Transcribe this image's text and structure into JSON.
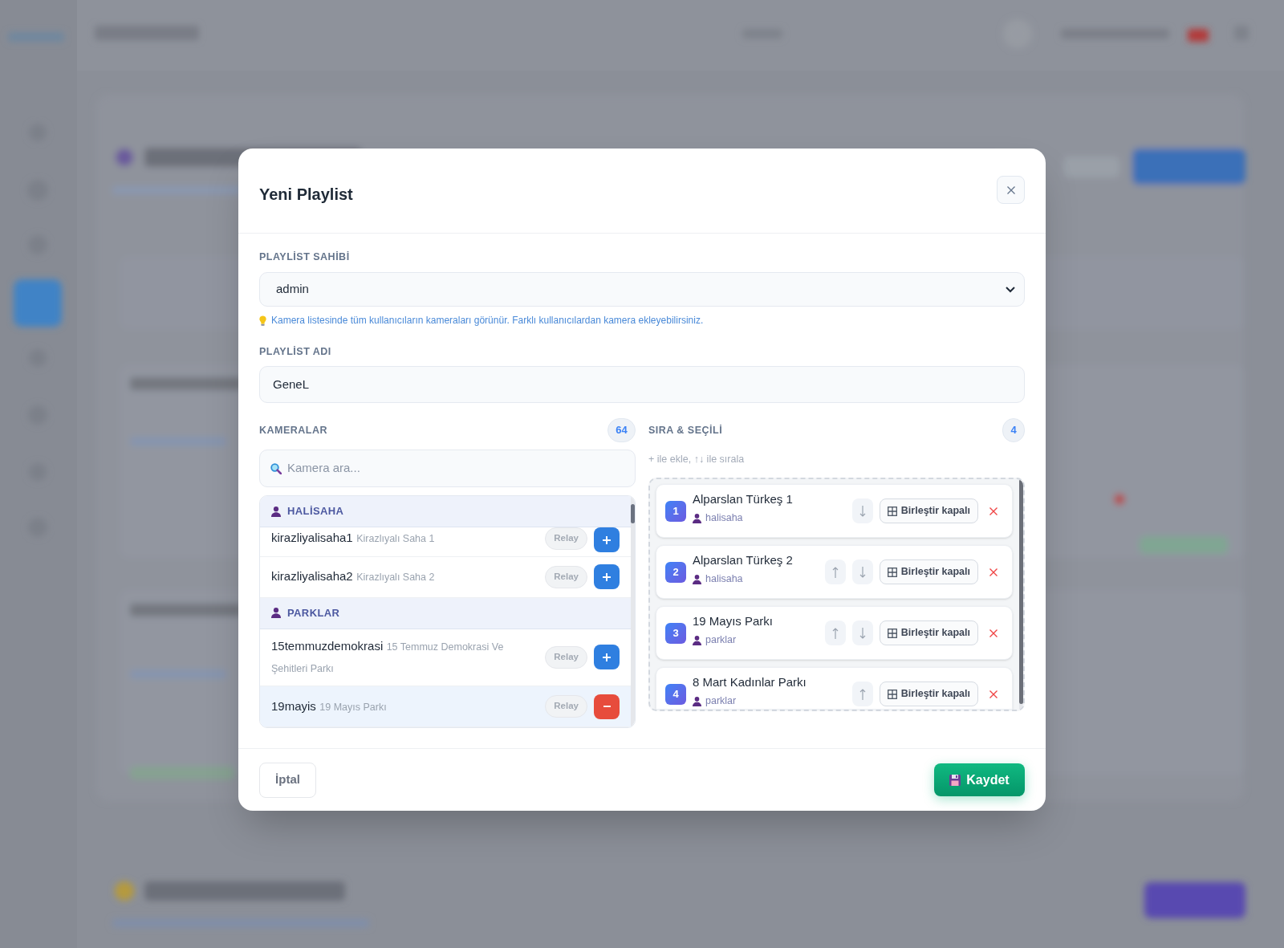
{
  "dialog": {
    "title": "Yeni Playlist"
  },
  "owner_field": {
    "label": "PLAYLİST SAHİBİ",
    "value": "admin",
    "hint": "Kamera listesinde tüm kullanıcıların kameraları görünür. Farklı kullanıcılardan kamera ekleyebilirsiniz."
  },
  "name_field": {
    "label": "PLAYLİST ADI",
    "value": "GeneL"
  },
  "cameras": {
    "title": "KAMERALAR",
    "count": "64",
    "search": {
      "placeholder": "Kamera ara..."
    },
    "groups": [
      {
        "name": "HALİSAHA",
        "items": [
          {
            "name": "kirazliyalisaha1",
            "description": "Kirazlıyalı Saha 1",
            "tag": "Relay",
            "selected": false
          },
          {
            "name": "kirazliyalisaha2",
            "description": "Kirazlıyalı Saha 2",
            "tag": "Relay",
            "selected": false
          }
        ]
      },
      {
        "name": "PARKLAR",
        "items": [
          {
            "name": "15temmuzdemokrasi",
            "description": "15 Temmuz Demokrasi Ve Şehitleri Parkı",
            "tag": "Relay",
            "selected": false
          },
          {
            "name": "19mayis",
            "description": "19 Mayıs Parkı",
            "tag": "Relay",
            "selected": true
          }
        ]
      }
    ]
  },
  "playlist": {
    "title": "SIRA & SEÇİLİ",
    "count": "4",
    "hint": "+ ile ekle, ↑↓ ile sırala",
    "items": [
      {
        "number": "1",
        "name": "Alparslan Türkeş 1",
        "owner": "halisaha",
        "can_move_up": false,
        "can_move_down": true,
        "merge": "Birleştir kapalı"
      },
      {
        "number": "2",
        "name": "Alparslan Türkeş 2",
        "owner": "halisaha",
        "can_move_up": true,
        "can_move_down": true,
        "merge": "Birleştir kapalı"
      },
      {
        "number": "3",
        "name": "19 Mayıs Parkı",
        "owner": "parklar",
        "can_move_up": true,
        "can_move_down": true,
        "merge": "Birleştir kapalı"
      },
      {
        "number": "4",
        "name": "8 Mart Kadınlar Parkı",
        "owner": "parklar",
        "can_move_up": true,
        "can_move_down": false,
        "merge": "Birleştir kapalı"
      }
    ]
  },
  "footer": {
    "cancel": "İptal",
    "save": "Kaydet"
  }
}
